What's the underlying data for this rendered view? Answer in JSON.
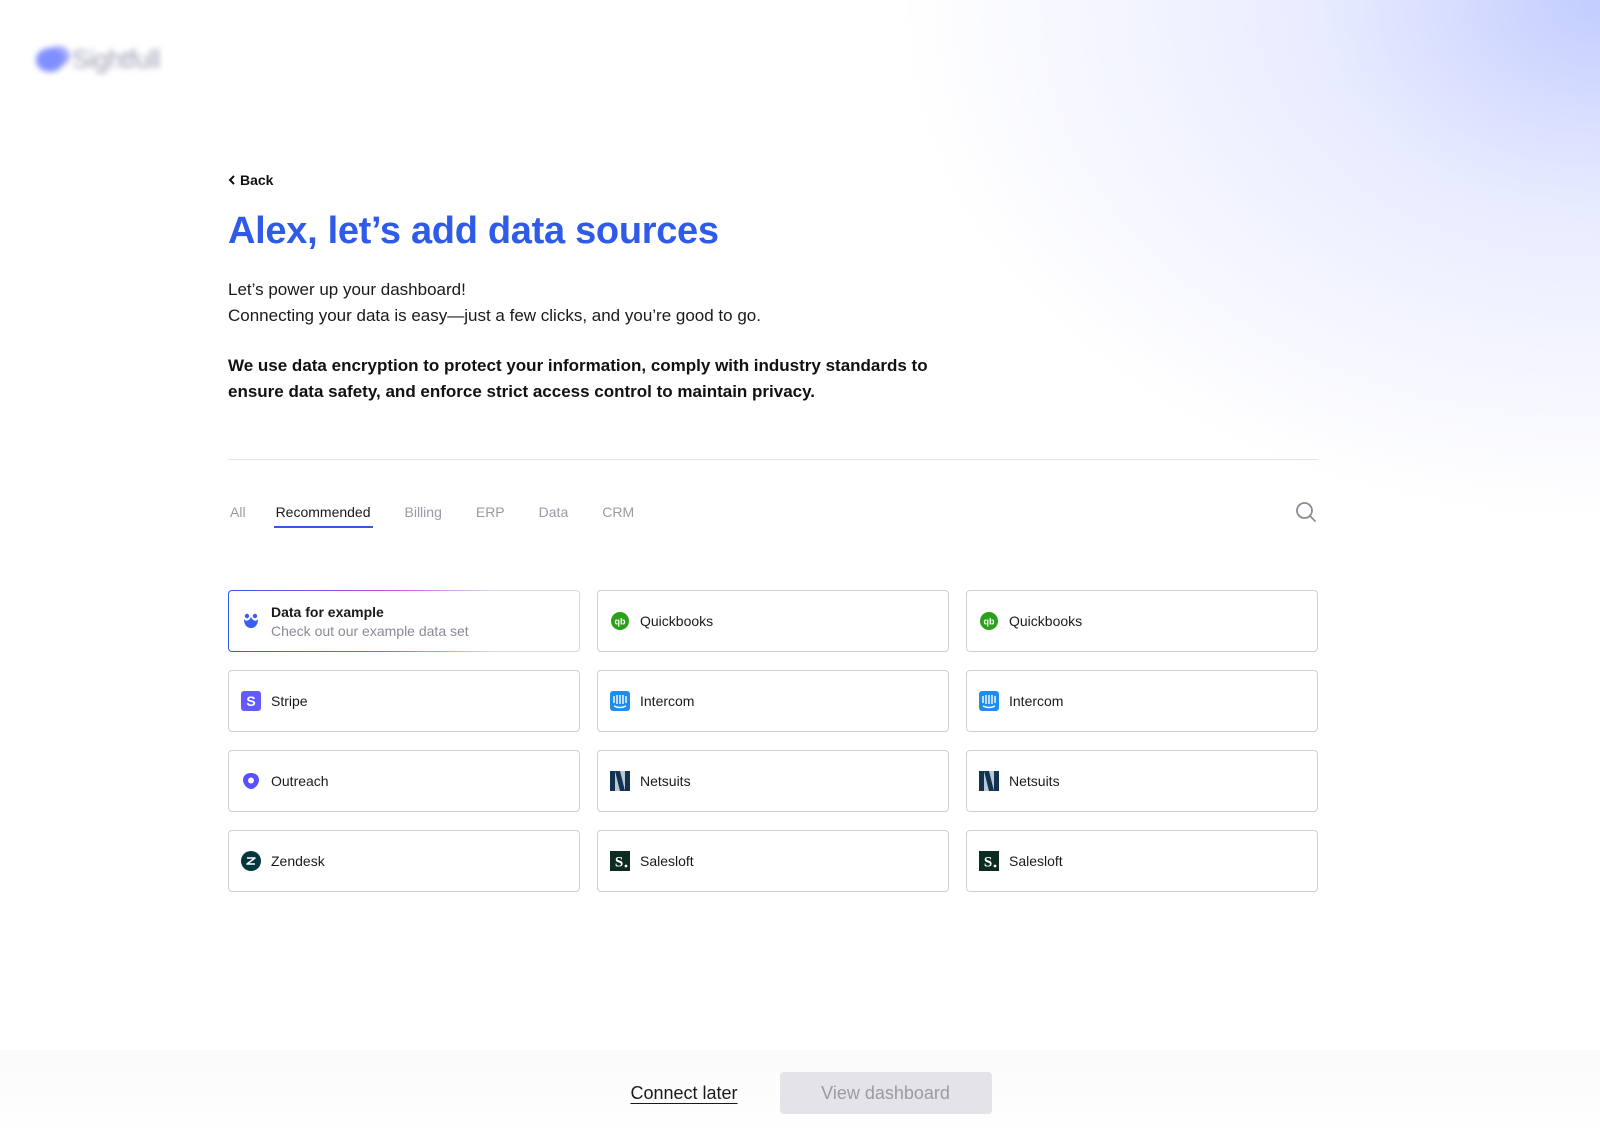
{
  "brand": {
    "name": "Sightfull",
    "accent": "#2f5be8"
  },
  "nav": {
    "back_label": "Back"
  },
  "header": {
    "title": "Alex, let’s add data sources",
    "intro_line1": "Let’s power up your dashboard!",
    "intro_line2": "Connecting your data is easy—just a few clicks, and you’re good to go.",
    "security_note": "We use data encryption to protect your information, comply with industry standards to ensure data safety, and enforce strict access control to maintain privacy."
  },
  "tabs": [
    {
      "label": "All"
    },
    {
      "label": "Recommended",
      "active": true
    },
    {
      "label": "Billing"
    },
    {
      "label": "ERP"
    },
    {
      "label": "Data"
    },
    {
      "label": "CRM"
    }
  ],
  "search": {
    "icon": "search-icon"
  },
  "sources": [
    {
      "name": "Data for example",
      "subtitle": "Check out our example data set",
      "icon": "sightfull-icon"
    },
    {
      "name": "Quickbooks",
      "icon": "quickbooks-icon"
    },
    {
      "name": "Quickbooks",
      "icon": "quickbooks-icon"
    },
    {
      "name": "Stripe",
      "icon": "stripe-icon"
    },
    {
      "name": "Intercom",
      "icon": "intercom-icon"
    },
    {
      "name": "Intercom",
      "icon": "intercom-icon"
    },
    {
      "name": "Outreach",
      "icon": "outreach-icon"
    },
    {
      "name": "Netsuits",
      "icon": "netsuite-icon"
    },
    {
      "name": "Netsuits",
      "icon": "netsuite-icon"
    },
    {
      "name": "Zendesk",
      "icon": "zendesk-icon"
    },
    {
      "name": "Salesloft",
      "icon": "salesloft-icon"
    },
    {
      "name": "Salesloft",
      "icon": "salesloft-icon"
    }
  ],
  "footer": {
    "connect_later_label": "Connect later",
    "view_dashboard_label": "View dashboard"
  }
}
